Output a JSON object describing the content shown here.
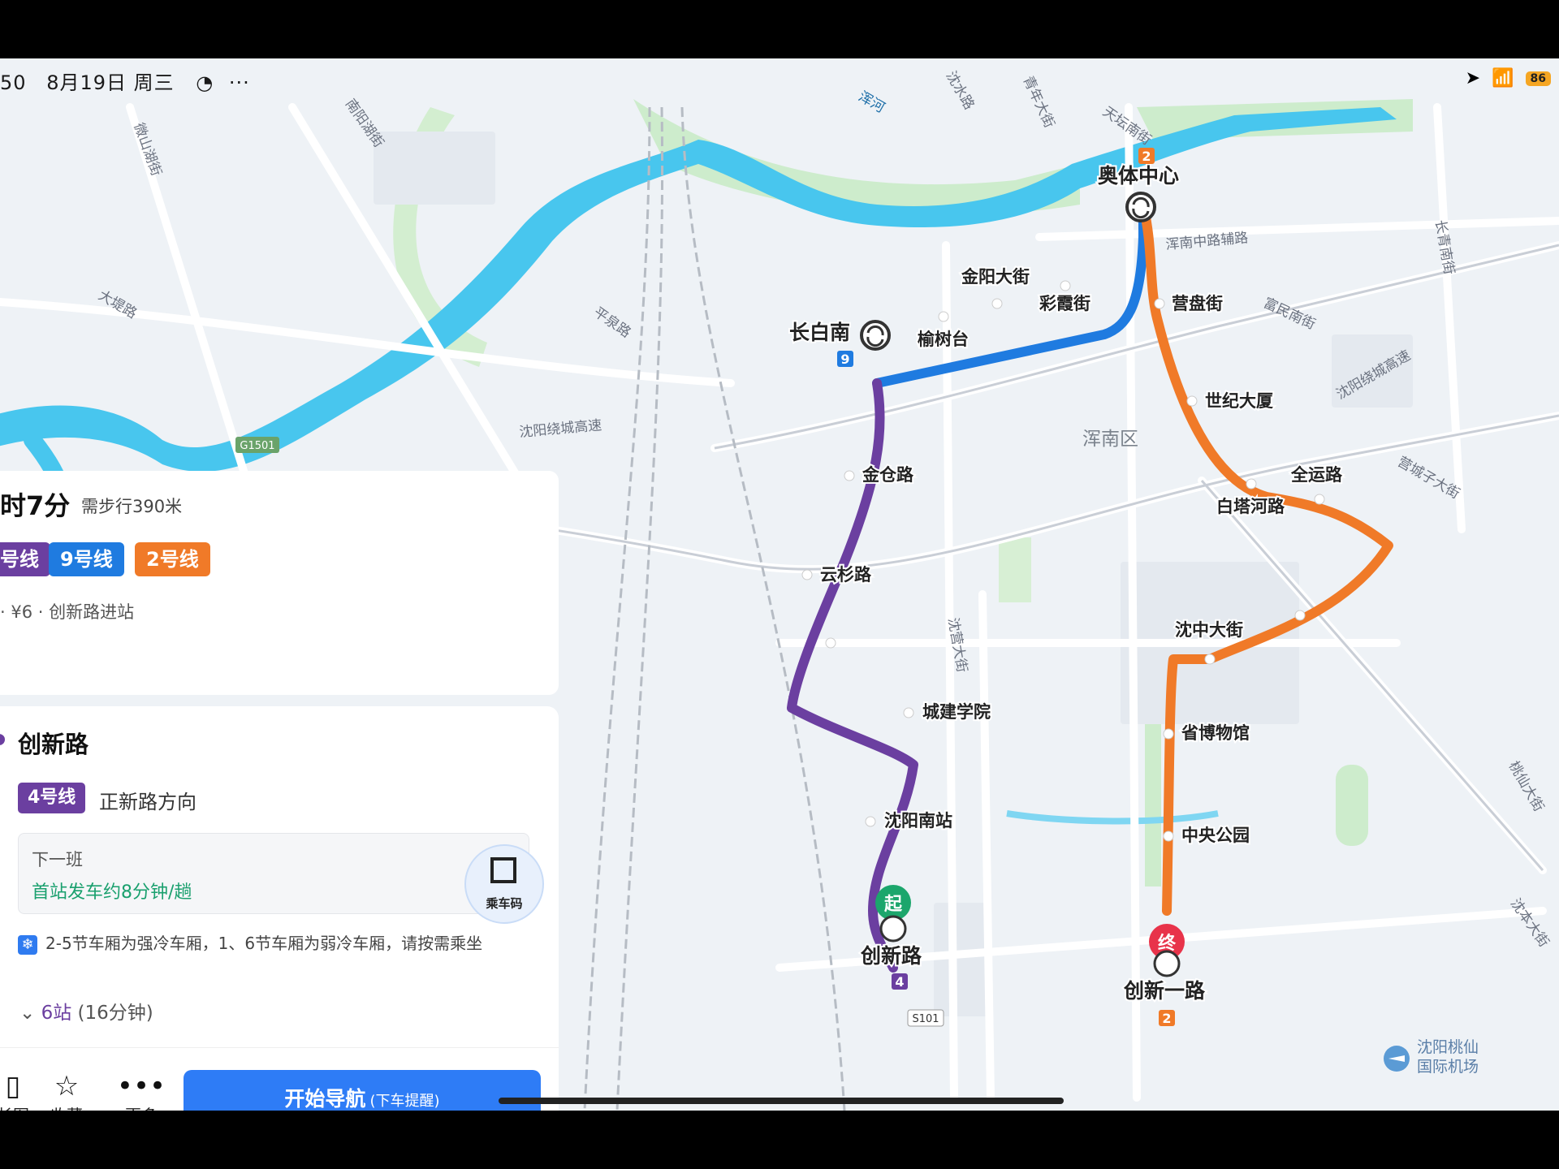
{
  "status": {
    "time": "50",
    "date": "8月19日 周三",
    "battery": "86"
  },
  "map": {
    "stations": {
      "aoti": "奥体中心",
      "changbainan": "长白南",
      "yingpanjie": "营盘街",
      "shiji": "世纪大厦",
      "jinyang": "金阳大街",
      "caixia": "彩霞街",
      "yushutai": "榆树台",
      "quanyun": "全运路",
      "baitahe": "白塔河路",
      "jincang": "金仓路",
      "yunshan": "云杉路",
      "chengjian": "城建学院",
      "shenzhong": "沈中大街",
      "shengbowu": "省博物馆",
      "shenyangnan": "沈阳南站",
      "zhongyang": "中央公园",
      "chuangxin": "创新路",
      "chuangxinyi": "创新一路"
    },
    "badges": {
      "aoti": "2",
      "changbainan": "9",
      "chuangxin": "4",
      "chuangxinyi": "2"
    },
    "markers": {
      "start": "起",
      "end": "终"
    },
    "roads": {
      "hunhe": "浑河",
      "shenshui": "沈水路",
      "qingnian": "青年大街",
      "tiantan": "天坛南街",
      "hunnanzhong": "浑南中路辅路",
      "changqingnan": "长青南街",
      "nanyanghu": "南阳湖街",
      "weishanhu": "微山湖街",
      "dadi": "大堤路",
      "pingquan": "平泉路",
      "raocheng1": "沈阳绕城高速",
      "raocheng2": "沈阳绕城高速",
      "fumin": "富民南街",
      "qucheng": "营城子大街",
      "shenying": "沈营大街",
      "taoxian": "桃仙大街",
      "shenben": "沈本大街",
      "g1501": "G1501",
      "s101": "S101"
    },
    "district": "浑南区",
    "airport": [
      "沈阳桃仙",
      "国际机场"
    ],
    "colors": {
      "line2": "#f07a28",
      "line9": "#1f7be0",
      "line4": "#6b3fa0",
      "river": "#48c6ee",
      "green": "#c9ecc4"
    }
  },
  "summary": {
    "duration": "时7分",
    "walk": "需步行390米",
    "lines": [
      {
        "label": "号线",
        "color": "#6b3fa0"
      },
      {
        "label": "9号线",
        "color": "#1f7be0"
      },
      {
        "label": "2号线",
        "color": "#f07a28"
      }
    ],
    "fare": "· ¥6 · 创新路进站"
  },
  "detail": {
    "station": "创新路",
    "line": "4号线",
    "direction": "正新路方向",
    "next_label": "下一班",
    "next_value": "首站发车约8分钟/趟",
    "qr_label": "乘车码",
    "notice": "2-5节车厢为强冷车厢，1、6节车厢为弱冷车厢，请按需乘坐",
    "stops": "6站",
    "stops_time": "(16分钟)"
  },
  "actions": {
    "longimg": "长图",
    "fav": "收藏",
    "more": "更多",
    "nav": "开始导航",
    "nav_sub": "(下车提醒)"
  }
}
